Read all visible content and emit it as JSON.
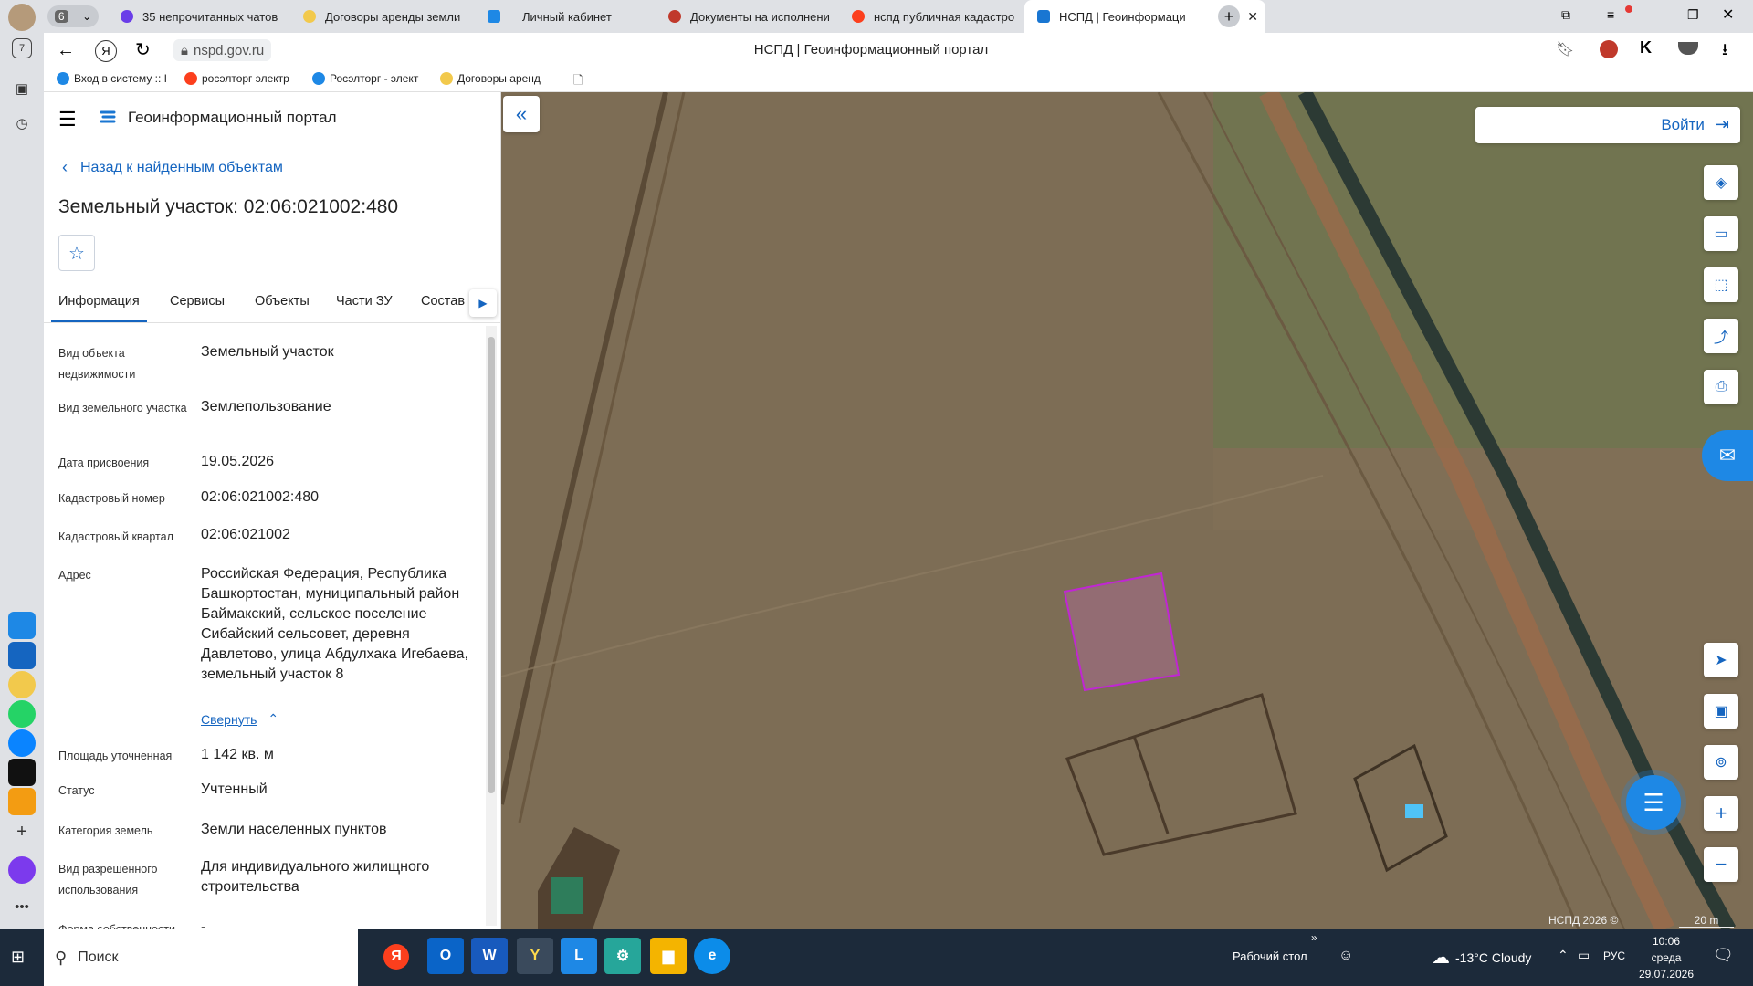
{
  "browser": {
    "tab_count": "6",
    "tabs": [
      {
        "label": "35 непрочитанных чатов",
        "color": "#6a3de8"
      },
      {
        "label": "Договоры аренды земли",
        "color": "#f2c94c"
      },
      {
        "label": "Личный кабинет",
        "color": "#1e88e5"
      },
      {
        "label": "Документы на исполнени",
        "color": "#c0392b"
      },
      {
        "label": "нспд публичная кадастро",
        "color": "#fc3f1d"
      },
      {
        "label": "НСПД | Геоинформаци",
        "color": "#1976d2"
      }
    ],
    "url": "nspd.gov.ru",
    "page_title": "НСПД | Геоинформационный портал",
    "bookmarks": [
      {
        "label": "Вход в систему :: I",
        "color": "#1e88e5"
      },
      {
        "label": "росэлторг электр",
        "color": "#fc3f1d"
      },
      {
        "label": "Росэлторг - элект",
        "color": "#1e88e5"
      },
      {
        "label": "Договоры аренд",
        "color": "#f2c94c"
      }
    ]
  },
  "portal": {
    "app_name": "Геоинформационный портал",
    "back_link": "Назад к найденным объектам",
    "object_title": "Земельный участок: 02:06:021002:480",
    "tabs": [
      "Информация",
      "Сервисы",
      "Объекты",
      "Части ЗУ",
      "Состав"
    ],
    "fields": [
      {
        "label": "Вид объекта недвижимости",
        "value": "Земельный участок"
      },
      {
        "label": "Вид земельного участка",
        "value": "Землепользование"
      },
      {
        "label": "Дата присвоения",
        "value": "19.05.2026"
      },
      {
        "label": "Кадастровый номер",
        "value": "02:06:021002:480"
      },
      {
        "label": "Кадастровый квартал",
        "value": "02:06:021002"
      },
      {
        "label": "Адрес",
        "value": "Российская Федерация, Республика Башкортостан, муниципальный район Баймакский, сельское поселение Сибайский сельсовет, деревня Давлетово, улица Абдулхака Игебаева, земельный участок 8"
      },
      {
        "label": "Площадь уточненная",
        "value": "1 142 кв. м"
      },
      {
        "label": "Статус",
        "value": "Учтенный"
      },
      {
        "label": "Категория земель",
        "value": "Земли населенных пунктов"
      },
      {
        "label": "Вид разрешенного использования",
        "value": "Для индивидуального жилищного строительства"
      },
      {
        "label": "Форма собственности",
        "value": "-"
      }
    ],
    "collapse_link": "Свернуть",
    "login_button": "Войти",
    "copyright": "НСПД 2026 ©",
    "scale_label": "20 m"
  },
  "taskbar": {
    "search_placeholder": "Поиск",
    "desktop_label": "Рабочий стол",
    "weather": "-13°C  Cloudy",
    "language": "РУС",
    "time": "10:06",
    "day": "среда",
    "date": "29.07.2026"
  },
  "colors": {
    "accent": "#1565c0",
    "parcel": "#c026d3",
    "taskbar": "#1c2a3a"
  }
}
